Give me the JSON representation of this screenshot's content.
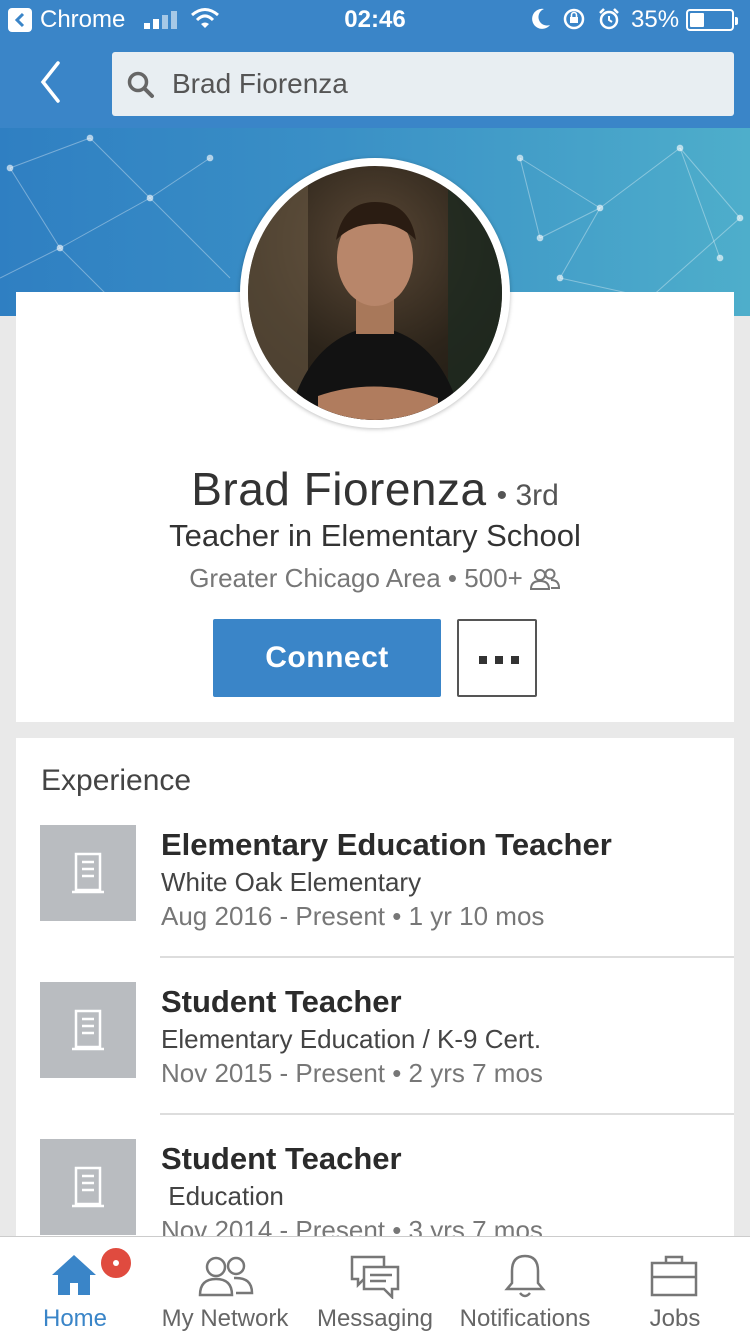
{
  "status_bar": {
    "app_name": "Chrome",
    "time": "02:46",
    "battery": "35%",
    "battery_level": 0.35
  },
  "search": {
    "value": "Brad Fiorenza"
  },
  "profile": {
    "name": "Brad Fiorenza",
    "degree": "• 3rd",
    "headline": "Teacher in Elementary School",
    "location_connections": "Greater Chicago Area • 500+",
    "connect_label": "Connect"
  },
  "experience": {
    "title": "Experience",
    "items": [
      {
        "title": "Elementary Education Teacher",
        "company": "White Oak Elementary",
        "dates": "Aug 2016 - Present • 1 yr 10 mos"
      },
      {
        "title": "Student Teacher",
        "company": "Elementary Education / K-9 Cert.",
        "dates": "Nov 2015 - Present • 2 yrs 7 mos"
      },
      {
        "title": "Student Teacher",
        "company": " Education",
        "dates": "Nov 2014 - Present • 3 yrs 7 mos"
      }
    ]
  },
  "tabs": [
    {
      "label": "Home",
      "icon": "home-icon",
      "active": true
    },
    {
      "label": "My Network",
      "icon": "network-icon"
    },
    {
      "label": "Messaging",
      "icon": "messaging-icon"
    },
    {
      "label": "Notifications",
      "icon": "bell-icon"
    },
    {
      "label": "Jobs",
      "icon": "briefcase-icon"
    }
  ],
  "colors": {
    "brand_blue": "#3a85c8",
    "badge_red": "#e04b3f"
  }
}
